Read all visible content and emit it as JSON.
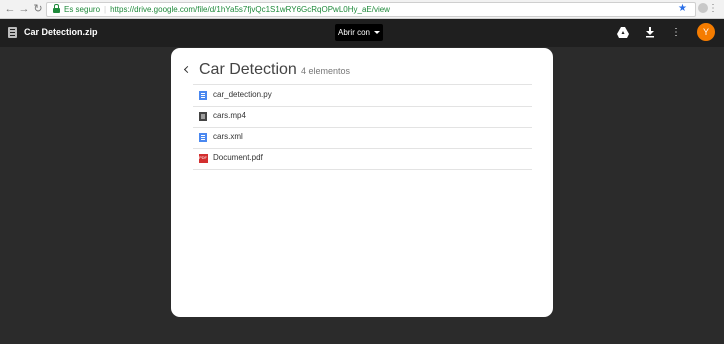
{
  "browser": {
    "secure_label": "Es seguro",
    "url": "https://drive.google.com/file/d/1hYa5s7fjvQc1S1wRY6GcRqOPwL0Hy_aE/view"
  },
  "viewer": {
    "file_title": "Car Detection.zip",
    "open_with_label": "Abrir con",
    "avatar_initial": "Y",
    "accent_color": "#f57c00"
  },
  "folder": {
    "title": "Car Detection",
    "count_label": "4 elementos",
    "items": [
      {
        "name": "car_detection.py",
        "icon": "document-icon"
      },
      {
        "name": "cars.mp4",
        "icon": "video-icon"
      },
      {
        "name": "cars.xml",
        "icon": "document-icon"
      },
      {
        "name": "Document.pdf",
        "icon": "pdf-icon"
      }
    ]
  }
}
